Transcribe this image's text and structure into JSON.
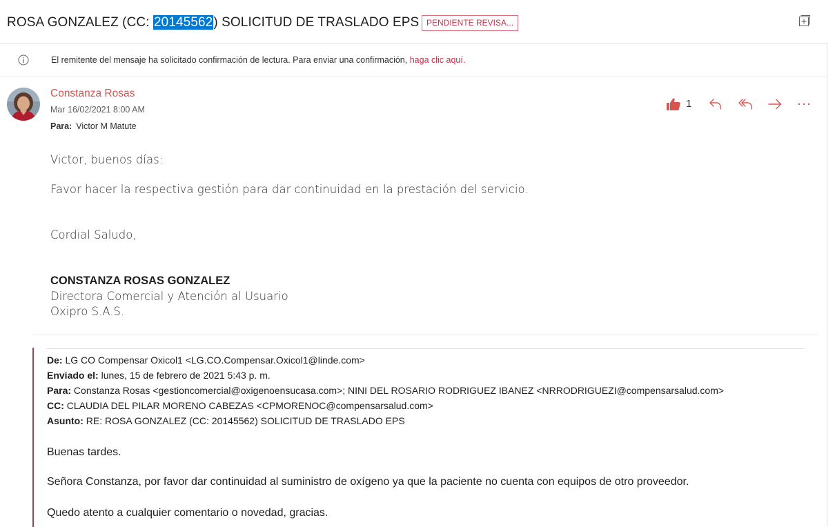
{
  "subject": {
    "prefix": "ROSA GONZALEZ (CC: ",
    "highlight": "20145562",
    "suffix": ") SOLICITUD DE TRASLADO EPS",
    "category": "PENDIENTE REVISA...",
    "icon": "open-in-new-window-icon"
  },
  "read_receipt": {
    "icon": "info-icon",
    "text": "El remitente del mensaje ha solicitado confirmación de lectura. Para enviar una confirmación, ",
    "link": "haga clic aquí."
  },
  "message": {
    "sender": "Constanza Rosas",
    "date": "Mar 16/02/2021 8:00 AM",
    "to_label": "Para:",
    "to": "Victor M Matute",
    "like_count": "1",
    "actions": [
      "like-icon",
      "reply-icon",
      "reply-all-icon",
      "forward-icon",
      "more-icon"
    ],
    "body": {
      "greeting": "Victor, buenos días:",
      "line1": "Favor hacer la respectiva gestión para dar continuidad en la prestación del servicio.",
      "closing": "Cordial Saludo,",
      "sig_name": "CONSTANZA ROSAS GONZALEZ",
      "sig_title": "Directora Comercial y Atención al Usuario",
      "sig_company": "Oxipro S.A.S."
    }
  },
  "quoted": {
    "from_label": "De:",
    "from": "LG CO Compensar Oxicol1 <LG.CO.Compensar.Oxicol1@linde.com>",
    "sent_label": "Enviado el:",
    "sent": "lunes, 15 de febrero de 2021 5:43 p. m.",
    "to_label": "Para:",
    "to": "Constanza Rosas <gestioncomercial@oxigenoensucasa.com>; NINI DEL ROSARIO RODRIGUEZ IBANEZ <NRRODRIGUEZI@compensarsalud.com>",
    "cc_label": "CC:",
    "cc": "CLAUDIA DEL PILAR MORENO CABEZAS <CPMORENOC@compensarsalud.com>",
    "subject_label": "Asunto:",
    "subject": "RE: ROSA GONZALEZ (CC: 20145562) SOLICITUD DE TRASLADO EPS",
    "greeting": "Buenas tardes.",
    "line1": "Señora Constanza, por favor dar continuidad al suministro de oxígeno ya que la paciente no cuenta con equipos de otro proveedor.",
    "line2": "Quedo atento a cualquier comentario o novedad, gracias."
  },
  "colors": {
    "accent": "#c4314b",
    "sender": "#d9534f",
    "selection": "#0078d4"
  }
}
